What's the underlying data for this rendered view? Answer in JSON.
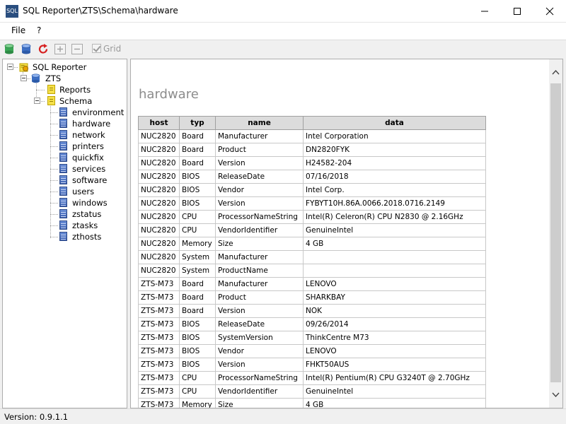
{
  "window": {
    "app_icon_text": "SQL",
    "title": "SQL Reporter\\ZTS\\Schema\\hardware"
  },
  "menu": {
    "items": [
      {
        "label": "File"
      },
      {
        "label": "?"
      }
    ]
  },
  "toolbar": {
    "buttons": [
      {
        "icon": "database-green-icon"
      },
      {
        "icon": "database-blue-icon"
      },
      {
        "icon": "refresh-icon"
      },
      {
        "icon": "expand-all-icon"
      },
      {
        "icon": "collapse-all-icon"
      }
    ],
    "grid_label": "Grid",
    "grid_checked": true,
    "grid_enabled": false
  },
  "tree": {
    "root": "SQL Reporter",
    "db": "ZTS",
    "folders": [
      "Reports",
      "Schema"
    ],
    "tables": [
      "environment",
      "hardware",
      "network",
      "printers",
      "quickfix",
      "services",
      "software",
      "users",
      "windows",
      "zstatus",
      "ztasks",
      "zthosts"
    ],
    "selected": "hardware"
  },
  "content": {
    "title": "hardware",
    "columns": [
      "host",
      "typ",
      "name",
      "data"
    ],
    "rows": [
      [
        "NUC2820",
        "Board",
        "Manufacturer",
        "Intel Corporation"
      ],
      [
        "NUC2820",
        "Board",
        "Product",
        "DN2820FYK"
      ],
      [
        "NUC2820",
        "Board",
        "Version",
        "H24582-204"
      ],
      [
        "NUC2820",
        "BIOS",
        "ReleaseDate",
        "07/16/2018"
      ],
      [
        "NUC2820",
        "BIOS",
        "Vendor",
        "Intel Corp."
      ],
      [
        "NUC2820",
        "BIOS",
        "Version",
        "FYBYT10H.86A.0066.2018.0716.2149"
      ],
      [
        "NUC2820",
        "CPU",
        "ProcessorNameString",
        "Intel(R) Celeron(R) CPU N2830 @ 2.16GHz"
      ],
      [
        "NUC2820",
        "CPU",
        "VendorIdentifier",
        "GenuineIntel"
      ],
      [
        "NUC2820",
        "Memory",
        "Size",
        "4 GB"
      ],
      [
        "NUC2820",
        "System",
        "Manufacturer",
        ""
      ],
      [
        "NUC2820",
        "System",
        "ProductName",
        ""
      ],
      [
        "ZTS-M73",
        "Board",
        "Manufacturer",
        "LENOVO"
      ],
      [
        "ZTS-M73",
        "Board",
        "Product",
        "SHARKBAY"
      ],
      [
        "ZTS-M73",
        "Board",
        "Version",
        "NOK"
      ],
      [
        "ZTS-M73",
        "BIOS",
        "ReleaseDate",
        "09/26/2014"
      ],
      [
        "ZTS-M73",
        "BIOS",
        "SystemVersion",
        "ThinkCentre M73"
      ],
      [
        "ZTS-M73",
        "BIOS",
        "Vendor",
        "LENOVO"
      ],
      [
        "ZTS-M73",
        "BIOS",
        "Version",
        "FHKT50AUS"
      ],
      [
        "ZTS-M73",
        "CPU",
        "ProcessorNameString",
        "Intel(R) Pentium(R) CPU G3240T @ 2.70GHz"
      ],
      [
        "ZTS-M73",
        "CPU",
        "VendorIdentifier",
        "GenuineIntel"
      ],
      [
        "ZTS-M73",
        "Memory",
        "Size",
        "4 GB"
      ]
    ]
  },
  "status": {
    "version": "Version: 0.9.1.1"
  },
  "colors": {
    "selection": "#cce8ff",
    "header_bg": "#dcdcdc",
    "title_gray": "#8c8c8c"
  }
}
